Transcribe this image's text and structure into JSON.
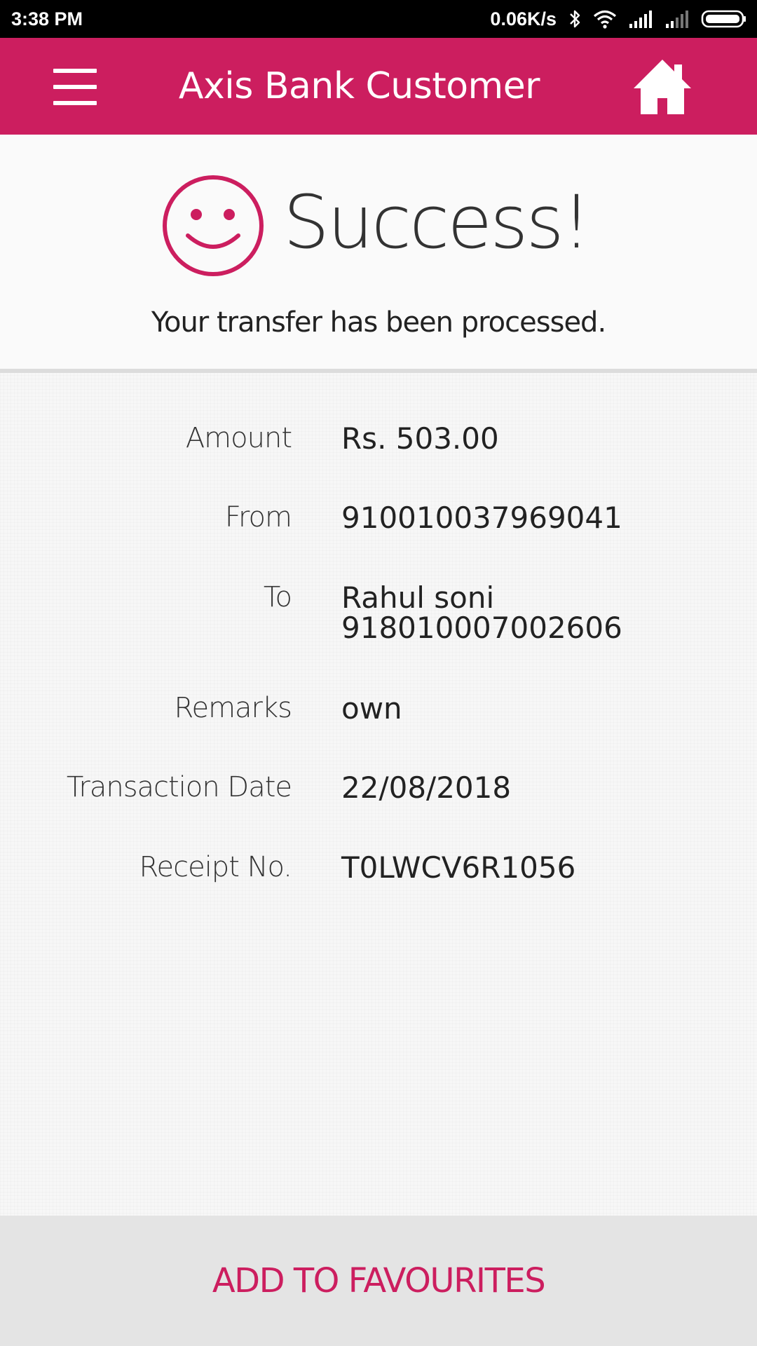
{
  "status_bar": {
    "time": "3:38 PM",
    "network_speed": "0.06K/s",
    "icons": [
      "bluetooth-icon",
      "wifi-icon",
      "signal-icon",
      "signal-weak-icon",
      "battery-icon"
    ]
  },
  "header": {
    "title": "Axis Bank Customer",
    "menu_icon": "hamburger-menu-icon",
    "home_icon": "home-icon"
  },
  "success": {
    "icon": "smiley-icon",
    "title": "Success!",
    "message": "Your transfer has been processed."
  },
  "details": {
    "amount": {
      "label": "Amount",
      "value": "Rs. 503.00"
    },
    "from": {
      "label": "From",
      "value": "910010037969041"
    },
    "to": {
      "label": "To",
      "name": "Rahul soni",
      "account": "918010007002606"
    },
    "remarks": {
      "label": "Remarks",
      "value": "own"
    },
    "transaction_date": {
      "label": "Transaction Date",
      "value": "22/08/2018"
    },
    "receipt_no": {
      "label": "Receipt No.",
      "value": "T0LWCV6R1056"
    }
  },
  "footer": {
    "button_label": "ADD TO FAVOURITES"
  },
  "colors": {
    "brand": "#cc1e5f",
    "status_bar": "#000000",
    "footer_bg": "#e4e4e4",
    "text": "#222222"
  }
}
